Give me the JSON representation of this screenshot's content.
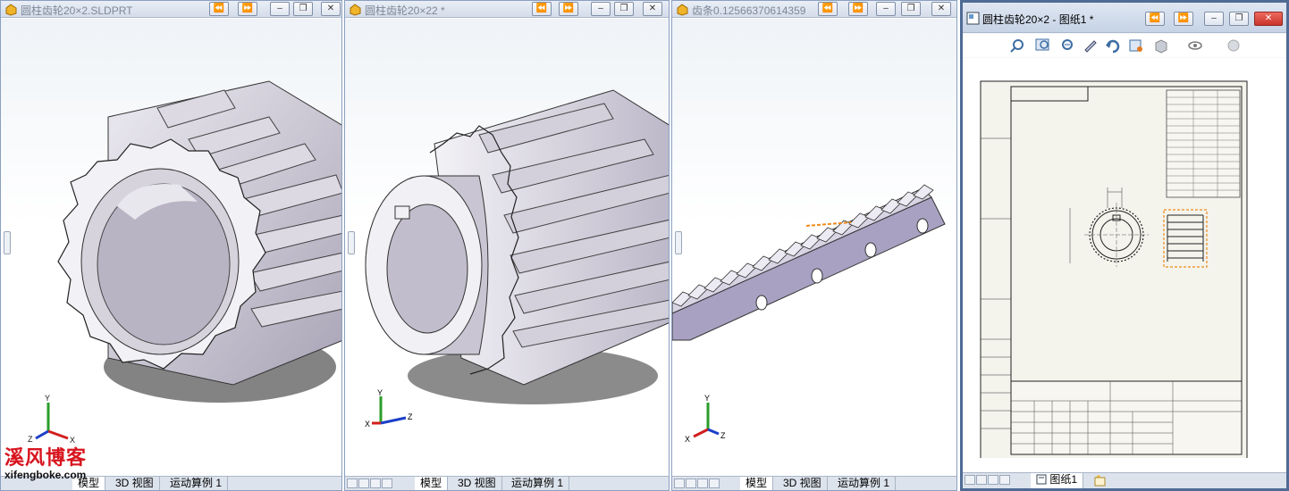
{
  "windows": [
    {
      "title": "圆柱齿轮20×2.SLDPRT",
      "tabs": [
        "模型",
        "3D 视图",
        "运动算例 1"
      ],
      "active_tab": 0
    },
    {
      "title": "圆柱齿轮20×22 *",
      "tabs": [
        "模型",
        "3D 视图",
        "运动算例 1"
      ],
      "active_tab": 0
    },
    {
      "title": "齿条0.12566370614359",
      "tabs": [
        "模型",
        "3D 视图",
        "运动算例 1"
      ],
      "active_tab": 0
    },
    {
      "title": "圆柱齿轮20×2 - 图纸1 *",
      "tabs": [
        "图纸1"
      ],
      "active_tab": 0
    }
  ],
  "window_buttons": {
    "prev": "⏪",
    "next": "⏩",
    "minimize": "–",
    "restore": "❐",
    "close": "✕"
  },
  "triad_labels": {
    "x": "X",
    "y": "Y",
    "z": "Z"
  },
  "watermark": {
    "text": "溪风博客",
    "url": "xifengboke.com"
  },
  "drawing_toolbar": {
    "icons": [
      "zoom-to-fit-icon",
      "zoom-area-icon",
      "zoom-in-out-icon",
      "pan-icon",
      "rotate-icon",
      "view-orientation-icon",
      "display-style-icon",
      "hide-show-icon",
      "appearance-icon"
    ]
  },
  "colors": {
    "gear": "#c9c5d2",
    "rack": "#a69fbf",
    "titlebar": "#dde4ef",
    "close_red": "#e04343",
    "sheet_bg": "#f4f3ec",
    "accent_orange": "#ef8a1a"
  }
}
